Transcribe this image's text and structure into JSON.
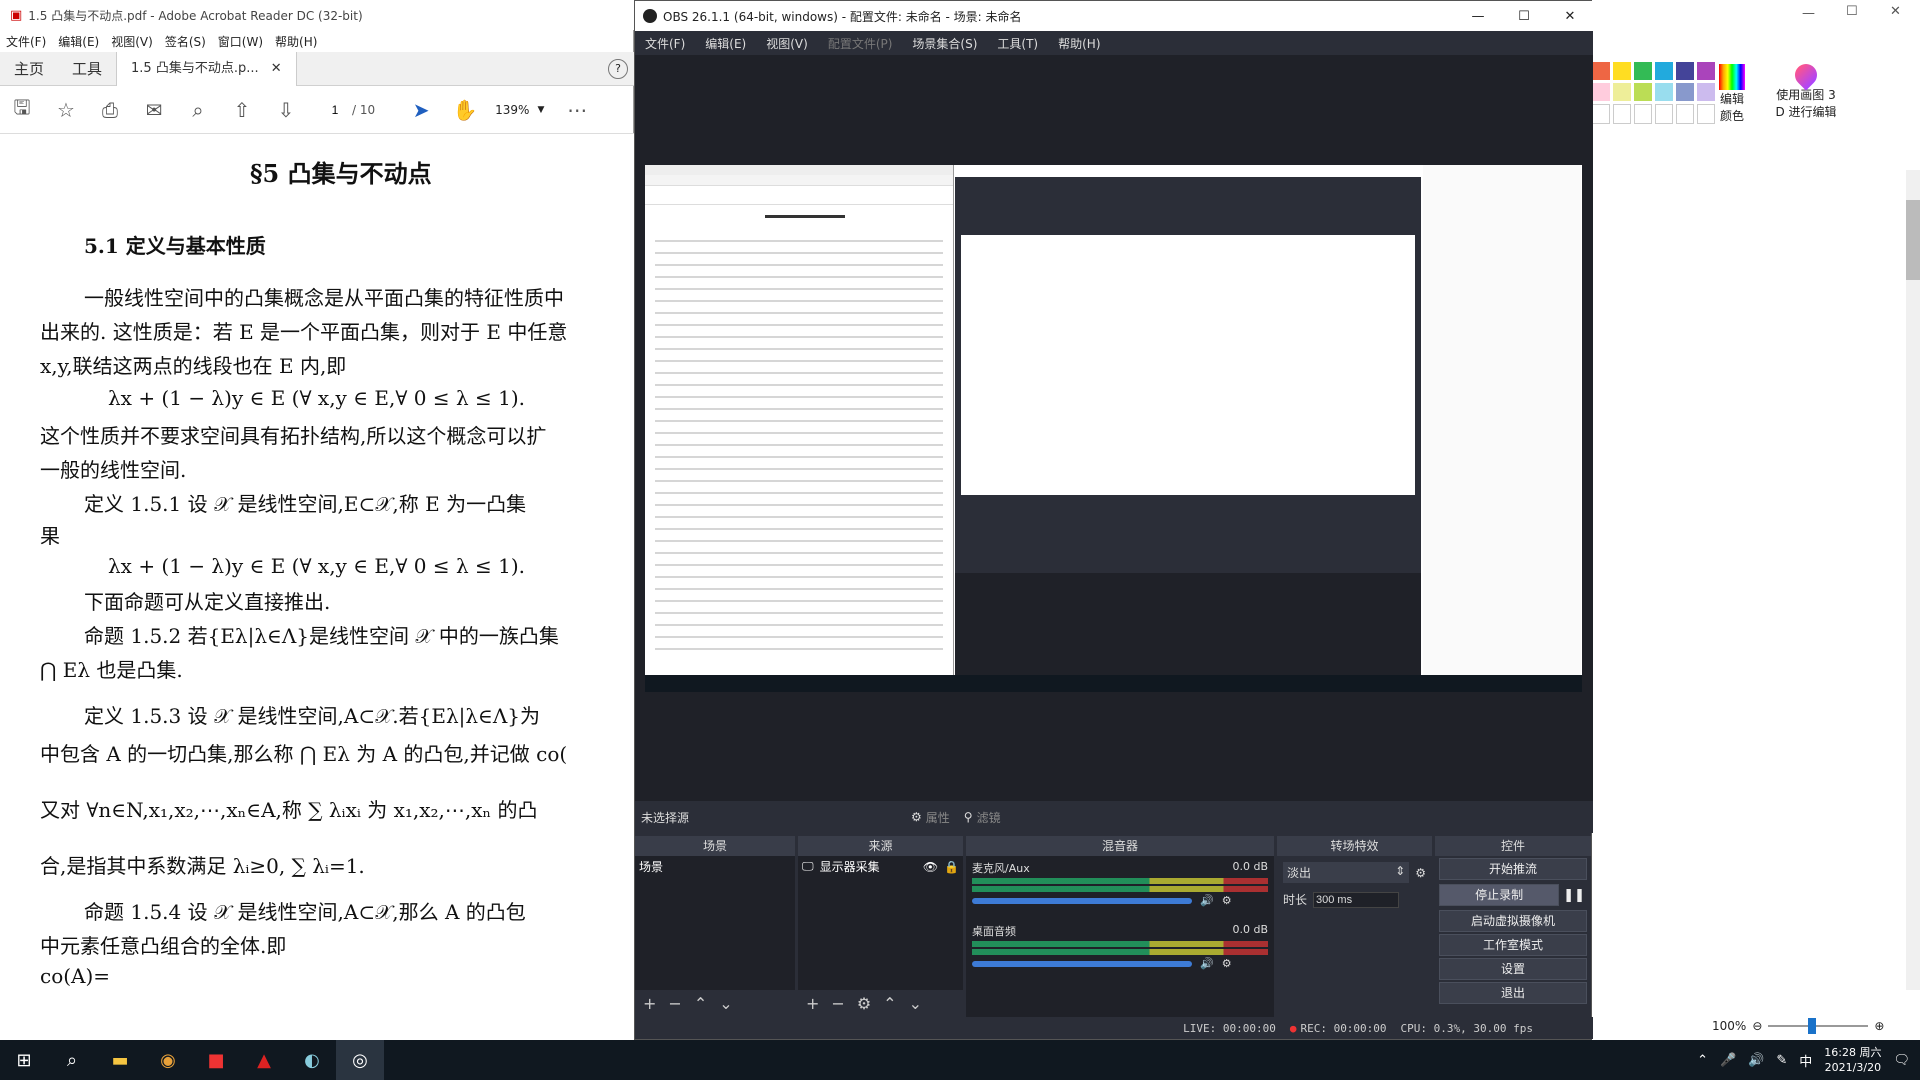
{
  "acrobat": {
    "title": "1.5 凸集与不动点.pdf - Adobe Acrobat Reader DC (32-bit)",
    "menus": [
      "文件(F)",
      "编辑(E)",
      "视图(V)",
      "签名(S)",
      "窗口(W)",
      "帮助(H)"
    ],
    "tabs": [
      "主页",
      "工具",
      "1.5 凸集与不动点.p..."
    ],
    "page_current": "1",
    "page_total": "/ 10",
    "zoom": "139%",
    "doc_lines": [
      "§5  凸集与不动点",
      "5.1  定义与基本性质",
      "一般线性空间中的凸集概念是从平面凸集的特征性质中",
      "出来的. 这性质是：若 E 是一个平面凸集，则对于 E 中任意",
      "x,y,联结这两点的线段也在 E 内,即",
      "λx + (1 − λ)y ∈ E   (∀ x,y ∈ E,∀ 0 ≤ λ ≤ 1).",
      "这个性质并不要求空间具有拓扑结构,所以这个概念可以扩",
      "一般的线性空间.",
      "定义 1.5.1   设 𝒳 是线性空间,E⊂𝒳,称 E 为一凸集",
      "果",
      "λx + (1 − λ)y ∈ E   (∀ x,y ∈ E,∀ 0 ≤ λ ≤ 1).",
      "下面命题可从定义直接推出.",
      "命题 1.5.2   若{Eλ|λ∈Λ}是线性空间 𝒳 中的一族凸集",
      "⋂ Eλ 也是凸集.",
      "定义 1.5.3   设 𝒳 是线性空间,A⊂𝒳.若{Eλ|λ∈Λ}为",
      "中包含 A 的一切凸集,那么称 ⋂ Eλ 为 A 的凸包,并记做 co(",
      "又对 ∀n∈N,x₁,x₂,⋯,xₙ∈A,称 ∑ λᵢxᵢ 为 x₁,x₂,⋯,xₙ 的凸",
      "合,是指其中系数满足 λᵢ≥0, ∑ λᵢ=1.",
      "命题 1.5.4   设 𝒳 是线性空间,A⊂𝒳,那么 A 的凸包",
      "中元素任意凸组合的全体.即",
      "co(A)="
    ]
  },
  "obs": {
    "title": "OBS 26.1.1 (64-bit, windows) - 配置文件: 未命名 - 场景: 未命名",
    "menus": [
      "文件(F)",
      "编辑(E)",
      "视图(V)",
      "配置文件(P)",
      "场景集合(S)",
      "工具(T)",
      "帮助(H)"
    ],
    "no_source": "未选择源",
    "props_btn": "属性",
    "filters_btn": "滤镜",
    "docks": {
      "scenes": {
        "title": "场景",
        "items": [
          "场景"
        ]
      },
      "sources": {
        "title": "来源",
        "items": [
          "显示器采集"
        ]
      },
      "mixer": {
        "title": "混音器",
        "channels": [
          {
            "name": "麦克风/Aux",
            "db": "0.0 dB"
          },
          {
            "name": "桌面音频",
            "db": "0.0 dB"
          }
        ]
      },
      "transitions": {
        "title": "转场特效",
        "type": "淡出",
        "duration_label": "时长",
        "duration": "300 ms"
      },
      "controls": {
        "title": "控件",
        "buttons": [
          "开始推流",
          "停止录制",
          "启动虚拟摄像机",
          "工作室模式",
          "设置",
          "退出"
        ]
      }
    },
    "status": {
      "live": "LIVE: 00:00:00",
      "rec": "REC: 00:00:00",
      "cpu": "CPU: 0.3%, 30.00 fps"
    }
  },
  "paint": {
    "edit_colors": "编辑\n颜色",
    "paint3d": "使用画图 3\nD 进行编辑",
    "zoom": "100%"
  },
  "taskbar": {
    "ime": "中",
    "time": "16:28 周六",
    "date": "2021/3/20"
  }
}
